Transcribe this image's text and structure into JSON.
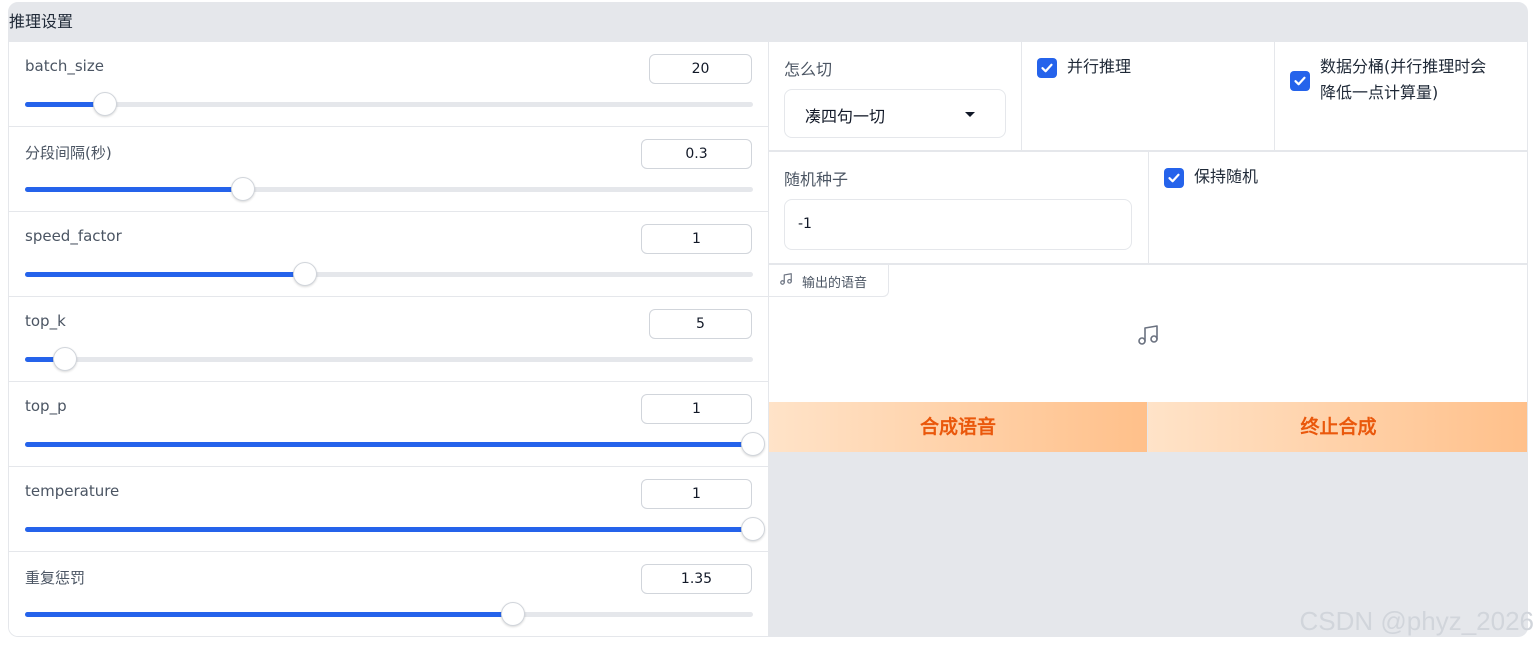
{
  "panel": {
    "title": "推理设置"
  },
  "sliders": [
    {
      "label": "batch_size",
      "value": "20",
      "fraction": 0.11
    },
    {
      "label": "分段间隔(秒)",
      "value": "0.3",
      "fraction": 0.3
    },
    {
      "label": "speed_factor",
      "value": "1",
      "fraction": 0.385
    },
    {
      "label": "top_k",
      "value": "5",
      "fraction": 0.055
    },
    {
      "label": "top_p",
      "value": "1",
      "fraction": 1.0
    },
    {
      "label": "temperature",
      "value": "1",
      "fraction": 1.0
    },
    {
      "label": "重复惩罚",
      "value": "1.35",
      "fraction": 0.67
    }
  ],
  "split": {
    "label": "怎么切",
    "value": "凑四句一切"
  },
  "parallel": {
    "label": "并行推理",
    "checked": true
  },
  "bucket": {
    "label_line1": "数据分桶(并行推理时会",
    "label_line2": "降低一点计算量)",
    "checked": true
  },
  "seed": {
    "label": "随机种子",
    "value": "-1"
  },
  "keep_random": {
    "label": "保持随机",
    "checked": true
  },
  "audio": {
    "label": "输出的语音",
    "icon": "music-note-icon"
  },
  "buttons": {
    "synthesize": "合成语音",
    "stop": "终止合成"
  },
  "watermark": "CSDN @phyz_2026",
  "colors": {
    "accent": "#2563eb",
    "button_text": "#ea580c"
  }
}
